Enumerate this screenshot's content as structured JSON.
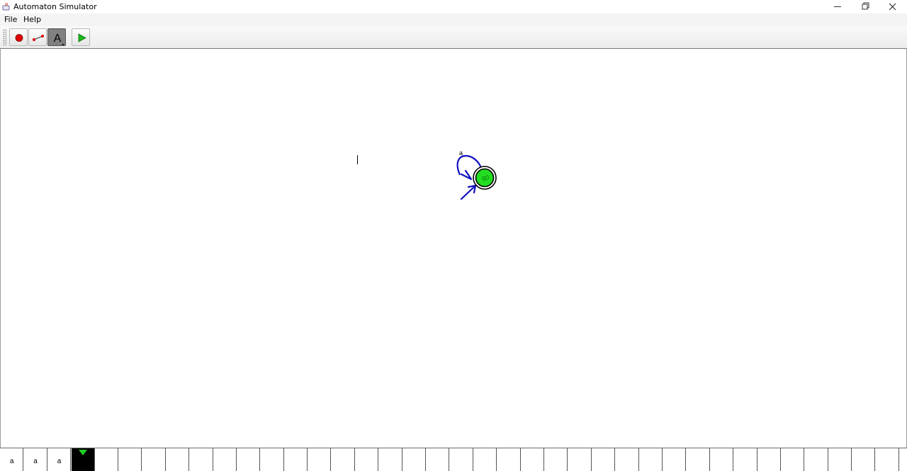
{
  "window": {
    "title": "Automaton Simulator",
    "controls": [
      "minimize-icon",
      "restore-icon",
      "close-icon"
    ]
  },
  "menubar": {
    "items": [
      {
        "label": "File"
      },
      {
        "label": "Help"
      }
    ]
  },
  "toolbar": {
    "tools": [
      {
        "name": "add-state-tool",
        "icon": "red-dot-icon"
      },
      {
        "name": "add-transition-tool",
        "icon": "arrow-tool-icon"
      },
      {
        "name": "text-tool",
        "icon": "letter-a-icon",
        "label": "A",
        "selected": true
      },
      {
        "name": "run-tool",
        "icon": "play-icon"
      }
    ]
  },
  "automaton": {
    "states": [
      {
        "id": "q0",
        "label": "q0",
        "initial": true,
        "accepting": true,
        "active": true,
        "fill": "#22dd22"
      }
    ],
    "transitions": [
      {
        "from": "q0",
        "to": "q0",
        "label": "a",
        "color": "#1010c0"
      }
    ]
  },
  "tape": {
    "cells": [
      "a",
      "a",
      "a",
      "",
      "",
      "",
      "",
      "",
      "",
      "",
      "",
      "",
      "",
      "",
      "",
      "",
      "",
      "",
      "",
      "",
      "",
      "",
      "",
      "",
      "",
      "",
      "",
      "",
      "",
      "",
      "",
      "",
      "",
      "",
      "",
      "",
      "",
      ""
    ],
    "head_index": 3,
    "head_color": "#000000",
    "marker_color": "#20d020"
  }
}
